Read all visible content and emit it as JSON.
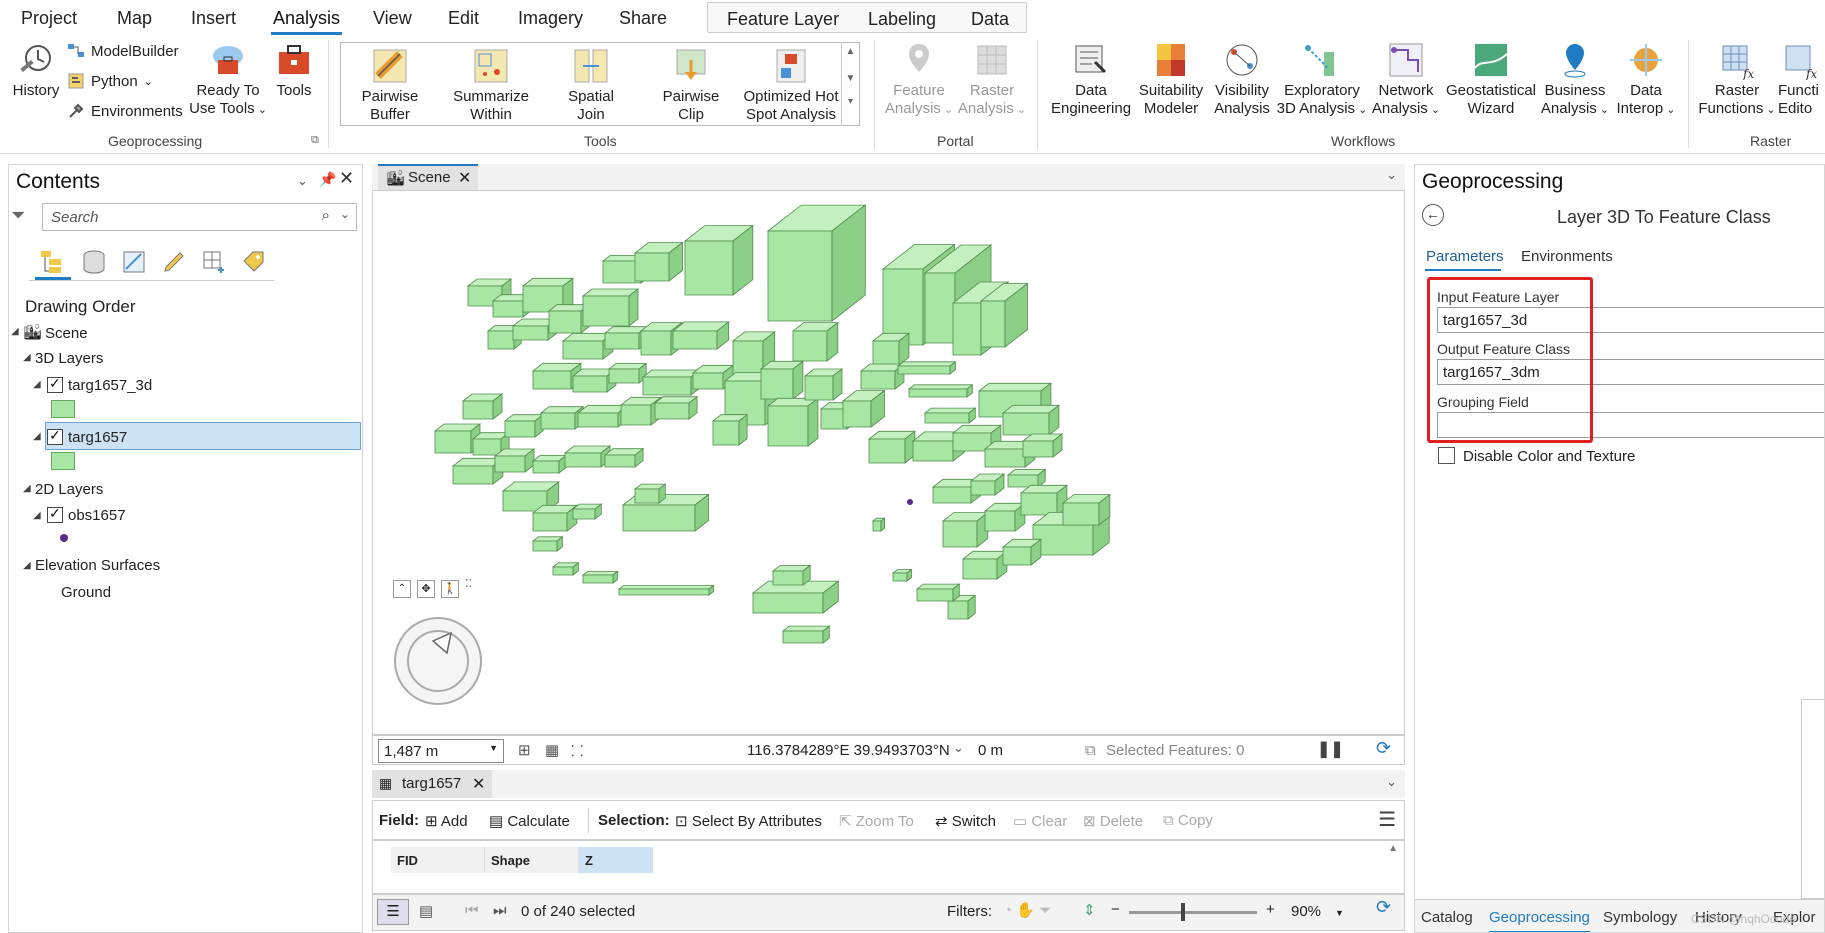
{
  "tabs": [
    "Project",
    "Map",
    "Insert",
    "Analysis",
    "View",
    "Edit",
    "Imagery",
    "Share"
  ],
  "active_tab": "Analysis",
  "contextual_tabs": [
    "Feature Layer",
    "Labeling",
    "Data"
  ],
  "ribbon": {
    "geoprocessing": {
      "label": "Geoprocessing",
      "history": "History",
      "modelbuilder": "ModelBuilder",
      "python": "Python",
      "environments": "Environments",
      "ready_to_use_1": "Ready To",
      "ready_to_use_2": "Use Tools",
      "tools": "Tools"
    },
    "tools": {
      "label": "Tools",
      "items": [
        {
          "l1": "Pairwise",
          "l2": "Buffer"
        },
        {
          "l1": "Summarize",
          "l2": "Within"
        },
        {
          "l1": "Spatial",
          "l2": "Join"
        },
        {
          "l1": "Pairwise",
          "l2": "Clip"
        },
        {
          "l1": "Optimized Hot",
          "l2": "Spot Analysis"
        }
      ]
    },
    "portal": {
      "label": "Portal",
      "feature_analysis_1": "Feature",
      "feature_analysis_2": "Analysis",
      "raster_analysis_1": "Raster",
      "raster_analysis_2": "Analysis"
    },
    "workflows": {
      "label": "Workflows",
      "items": [
        {
          "l1": "Data",
          "l2": "Engineering"
        },
        {
          "l1": "Suitability",
          "l2": "Modeler"
        },
        {
          "l1": "Visibility",
          "l2": "Analysis"
        },
        {
          "l1": "Exploratory",
          "l2": "3D Analysis"
        },
        {
          "l1": "Network",
          "l2": "Analysis"
        },
        {
          "l1": "Geostatistical",
          "l2": "Wizard"
        },
        {
          "l1": "Business",
          "l2": "Analysis"
        },
        {
          "l1": "Data",
          "l2": "Interop"
        }
      ]
    },
    "raster": {
      "label": "Raster",
      "raster_functions_1": "Raster",
      "raster_functions_2": "Functions",
      "function_editor_1": "Functi",
      "function_editor_2": "Edito"
    }
  },
  "contents": {
    "title": "Contents",
    "search_placeholder": "Search",
    "drawing_order": "Drawing Order",
    "scene": "Scene",
    "layers_3d": "3D Layers",
    "layer_3d_a": "targ1657_3d",
    "layer_3d_b": "targ1657",
    "layers_2d": "2D Layers",
    "layer_2d_a": "obs1657",
    "elevation": "Elevation Surfaces",
    "ground": "Ground"
  },
  "scene_view": {
    "tab": "Scene",
    "scale": "1,487 m",
    "coords": "116.3784289°E 39.9493703°N",
    "elev": "0 m",
    "selected": "Selected Features: 0"
  },
  "table": {
    "tab": "targ1657",
    "field_label": "Field:",
    "add": "Add",
    "calculate": "Calculate",
    "selection_label": "Selection:",
    "select_by_attributes": "Select By Attributes",
    "zoom_to": "Zoom To",
    "switch": "Switch",
    "clear": "Clear",
    "delete": "Delete",
    "copy": "Copy",
    "columns": [
      "FID",
      "Shape",
      "Z"
    ],
    "count": "0 of 240 selected",
    "filters": "Filters:",
    "zoom": "90%"
  },
  "geoprocessing": {
    "title": "Geoprocessing",
    "tool": "Layer 3D To Feature Class",
    "tab_params": "Parameters",
    "tab_env": "Environments",
    "input_label": "Input Feature Layer",
    "input_value": "targ1657_3d",
    "output_label": "Output Feature Class",
    "output_value": "targ1657_3dm",
    "grouping_label": "Grouping Field",
    "grouping_value": "",
    "disable_color": "Disable Color and Texture",
    "bottom_tabs": [
      "Catalog",
      "Geoprocessing",
      "Symbology",
      "History",
      "Explor"
    ],
    "watermark": "CSDN @hqhOcode"
  },
  "colors": {
    "accent": "#1f7bc4",
    "building_fill": "#a8e6a3",
    "building_edge": "#4f8c4b",
    "highlight": "#e02020"
  }
}
